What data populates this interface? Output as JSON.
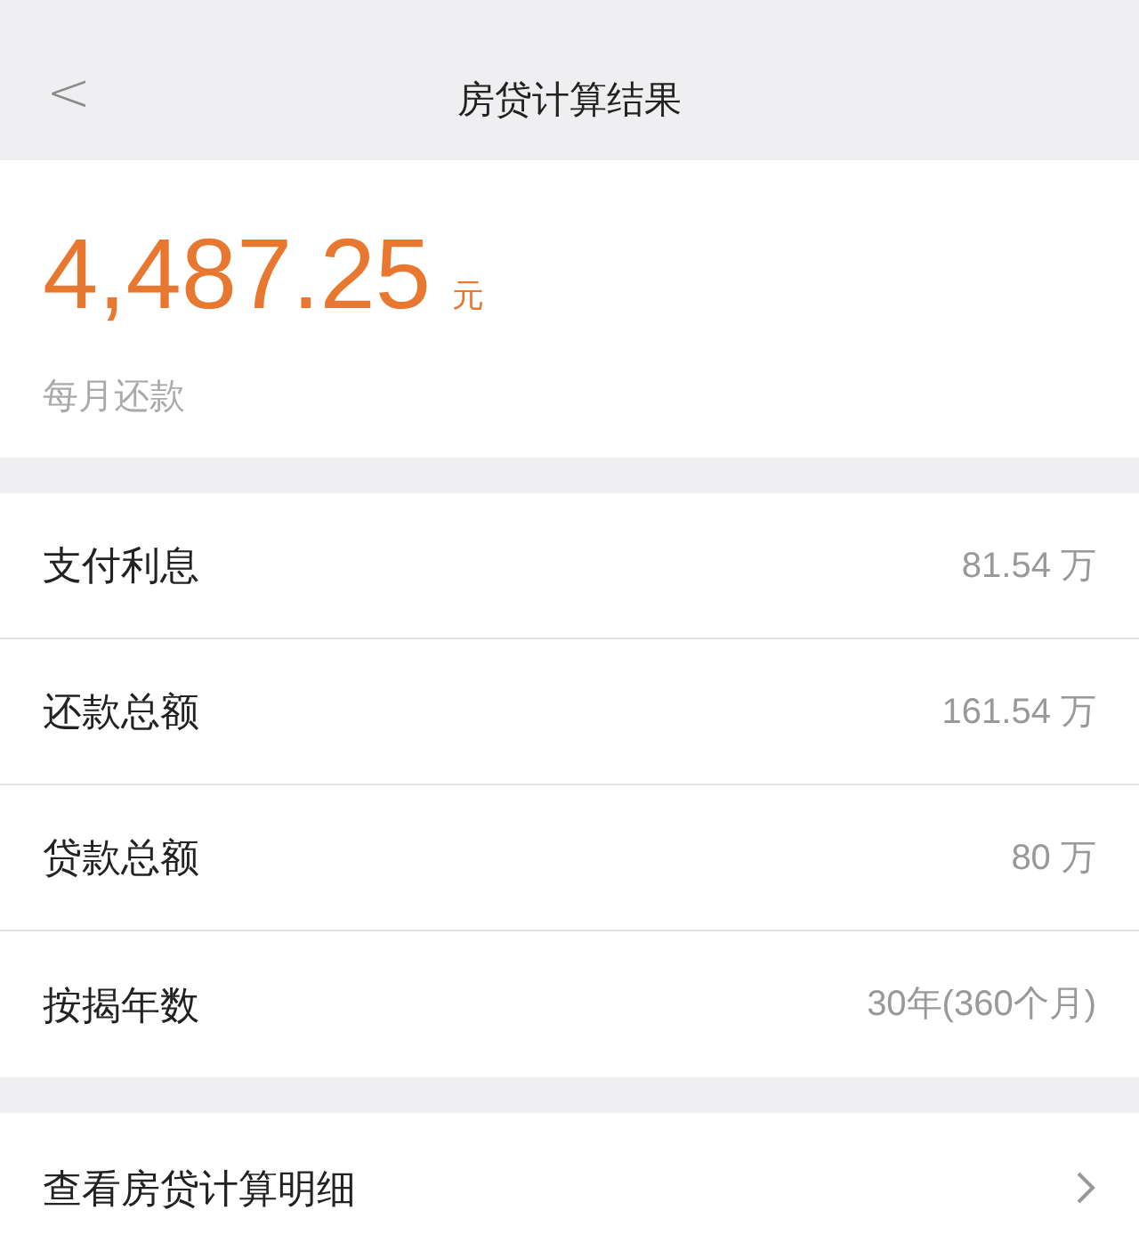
{
  "header": {
    "back": "<",
    "title": "房贷计算结果"
  },
  "summary": {
    "amount": "4,487.25",
    "unit": "元",
    "label": "每月还款"
  },
  "rows": [
    {
      "label": "支付利息",
      "value": "81.54 万"
    },
    {
      "label": "还款总额",
      "value": "161.54 万"
    },
    {
      "label": "贷款总额",
      "value": "80 万"
    },
    {
      "label": "按揭年数",
      "value": "30年(360个月)"
    }
  ],
  "detail_link": {
    "label": "查看房贷计算明细"
  }
}
